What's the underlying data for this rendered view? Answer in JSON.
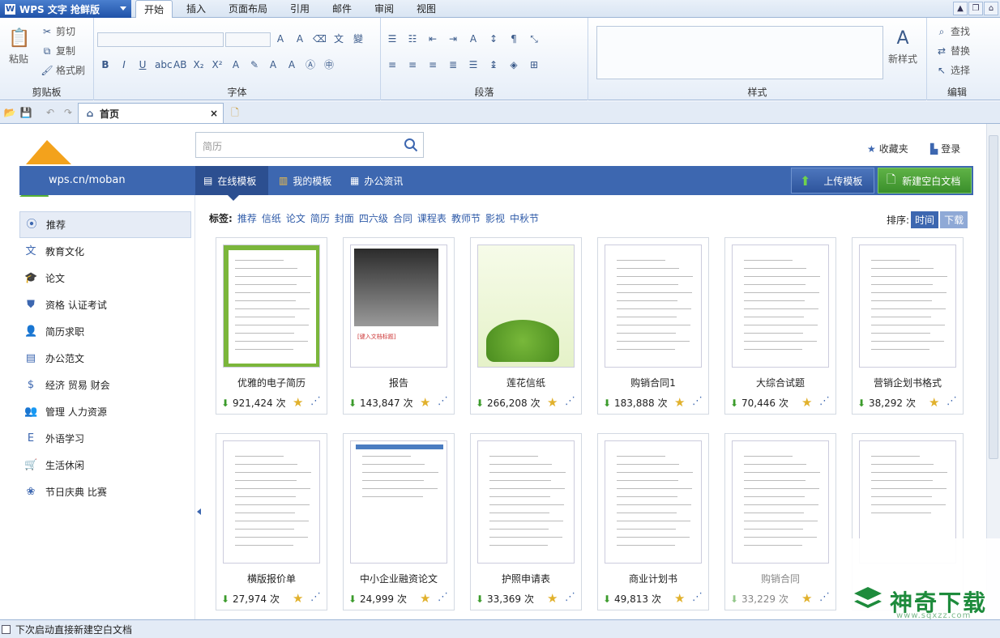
{
  "app": {
    "title": "WPS 文字 抢鲜版"
  },
  "ribbon_tabs": [
    "开始",
    "插入",
    "页面布局",
    "引用",
    "邮件",
    "审阅",
    "视图"
  ],
  "ribbon": {
    "clipboard": {
      "paste": "粘贴",
      "cut": "剪切",
      "copy": "复制",
      "format_painter": "格式刷",
      "group": "剪贴板"
    },
    "font": {
      "group": "字体"
    },
    "paragraph": {
      "group": "段落"
    },
    "styles": {
      "group": "样式",
      "new_style": "新样式"
    },
    "edit": {
      "find": "查找",
      "replace": "替换",
      "select": "选择",
      "group": "编辑"
    }
  },
  "doc_tab": {
    "title": "首页"
  },
  "search": {
    "placeholder": "简历"
  },
  "top_links": {
    "favorites": "收藏夹",
    "login": "登录"
  },
  "site": {
    "url": "wps.cn/moban"
  },
  "nav": {
    "tabs": [
      "在线模板",
      "我的模板",
      "办公资讯"
    ],
    "upload": "上传模板",
    "new_blank": "新建空白文档"
  },
  "sidebar": [
    {
      "label": "推荐",
      "icon": "target-icon"
    },
    {
      "label": "教育文化",
      "icon": "education-icon"
    },
    {
      "label": "论文",
      "icon": "graduation-cap-icon"
    },
    {
      "label": "资格 认证考试",
      "icon": "certificate-icon"
    },
    {
      "label": "简历求职",
      "icon": "person-icon"
    },
    {
      "label": "办公范文",
      "icon": "document-icon"
    },
    {
      "label": "经济 贸易 财会",
      "icon": "dollar-icon"
    },
    {
      "label": "管理 人力资源",
      "icon": "people-icon"
    },
    {
      "label": "外语学习",
      "icon": "letter-e-icon"
    },
    {
      "label": "生活休闲",
      "icon": "cart-icon"
    },
    {
      "label": "节日庆典 比赛",
      "icon": "balloons-icon"
    }
  ],
  "tags": {
    "label": "标签:",
    "items": [
      "推荐",
      "信纸",
      "论文",
      "简历",
      "封面",
      "四六级",
      "合同",
      "课程表",
      "教师节",
      "影视",
      "中秋节"
    ]
  },
  "sort": {
    "label": "排序:",
    "time": "时间",
    "download": "下载"
  },
  "templates": [
    {
      "title": "优雅的电子简历",
      "count": "921,424",
      "unit": "次"
    },
    {
      "title": "报告",
      "count": "143,847",
      "unit": "次"
    },
    {
      "title": "莲花信纸",
      "count": "266,208",
      "unit": "次"
    },
    {
      "title": "购销合同1",
      "count": "183,888",
      "unit": "次"
    },
    {
      "title": "大综合试题",
      "count": "70,446",
      "unit": "次"
    },
    {
      "title": "营销企划书格式",
      "count": "38,292",
      "unit": "次"
    },
    {
      "title": "横版报价单",
      "count": "27,974",
      "unit": "次"
    },
    {
      "title": "中小企业融资论文",
      "count": "24,999",
      "unit": "次"
    },
    {
      "title": "护照申请表",
      "count": "33,369",
      "unit": "次"
    },
    {
      "title": "商业计划书",
      "count": "49,813",
      "unit": "次"
    },
    {
      "title": "购销合同",
      "count": "33,229",
      "unit": "次"
    },
    {
      "title": "",
      "count": "",
      "unit": ""
    }
  ],
  "status": {
    "startup_checkbox": "下次启动直接新建空白文档"
  },
  "watermark": {
    "text": "神奇下载",
    "url": "www.sqxzz.com"
  },
  "colors": {
    "accent": "#3d67b0",
    "green": "#4aa535",
    "nav": "#3d67b0"
  }
}
